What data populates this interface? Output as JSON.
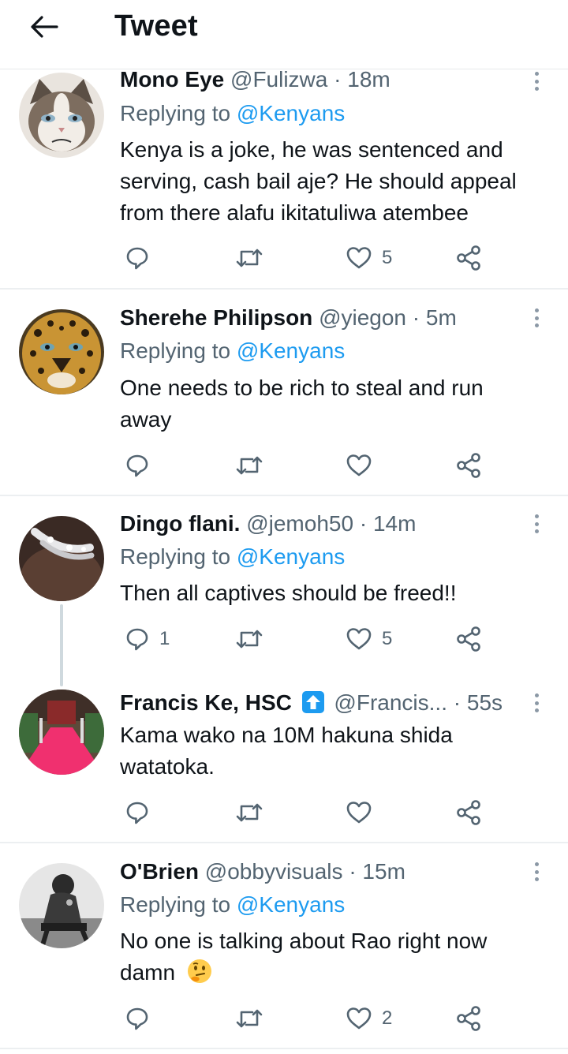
{
  "header": {
    "title": "Tweet"
  },
  "replies_prefix": "Replying to",
  "tweets": [
    {
      "name": "Mono Eye",
      "handle": "@Fulizwa",
      "dot": "·",
      "time": "18m",
      "reply_to": "@Kenyans",
      "text_lines": [
        "Kenya is a joke, he was sentenced and",
        "serving, cash bail aje? He should appeal",
        "from there alafu ikitatuliwa atembee"
      ],
      "reply_count": "",
      "retweet_count": "",
      "like_count": "5"
    },
    {
      "name": "Sherehe Philipson",
      "handle": "@yiegon",
      "dot": "·",
      "time": "5m",
      "reply_to": "@Kenyans",
      "text_lines": [
        "One needs to be rich to steal and run",
        "away"
      ],
      "reply_count": "",
      "retweet_count": "",
      "like_count": ""
    },
    {
      "name": "Dingo flani.",
      "handle": "@jemoh50",
      "dot": "·",
      "time": "14m",
      "reply_to": "@Kenyans",
      "text_lines": [
        "Then all captives should be freed!!"
      ],
      "reply_count": "1",
      "retweet_count": "",
      "like_count": "5"
    },
    {
      "name": "Francis Ke, HSC",
      "handle": "@Francis...",
      "dot": "·",
      "time": "55s",
      "reply_to": "",
      "text_lines": [
        "Kama wako na 10M hakuna shida",
        "watatoka."
      ],
      "reply_count": "",
      "retweet_count": "",
      "like_count": ""
    },
    {
      "name": "O'Brien",
      "handle": "@obbyvisuals",
      "dot": "·",
      "time": "15m",
      "reply_to": "@Kenyans",
      "text_lines": [
        "No one is talking about Rao right now",
        "damn"
      ],
      "reply_count": "",
      "retweet_count": "",
      "like_count": "2"
    }
  ],
  "colors": {
    "link": "#1d9bf0",
    "secondary": "#536471",
    "text": "#0f1419",
    "badge": "#1d9bf0"
  },
  "icons": [
    "back-arrow-icon",
    "more-icon",
    "reply-icon",
    "retweet-icon",
    "like-icon",
    "share-icon",
    "up-arrow-badge-icon",
    "thinking-face-emoji"
  ]
}
